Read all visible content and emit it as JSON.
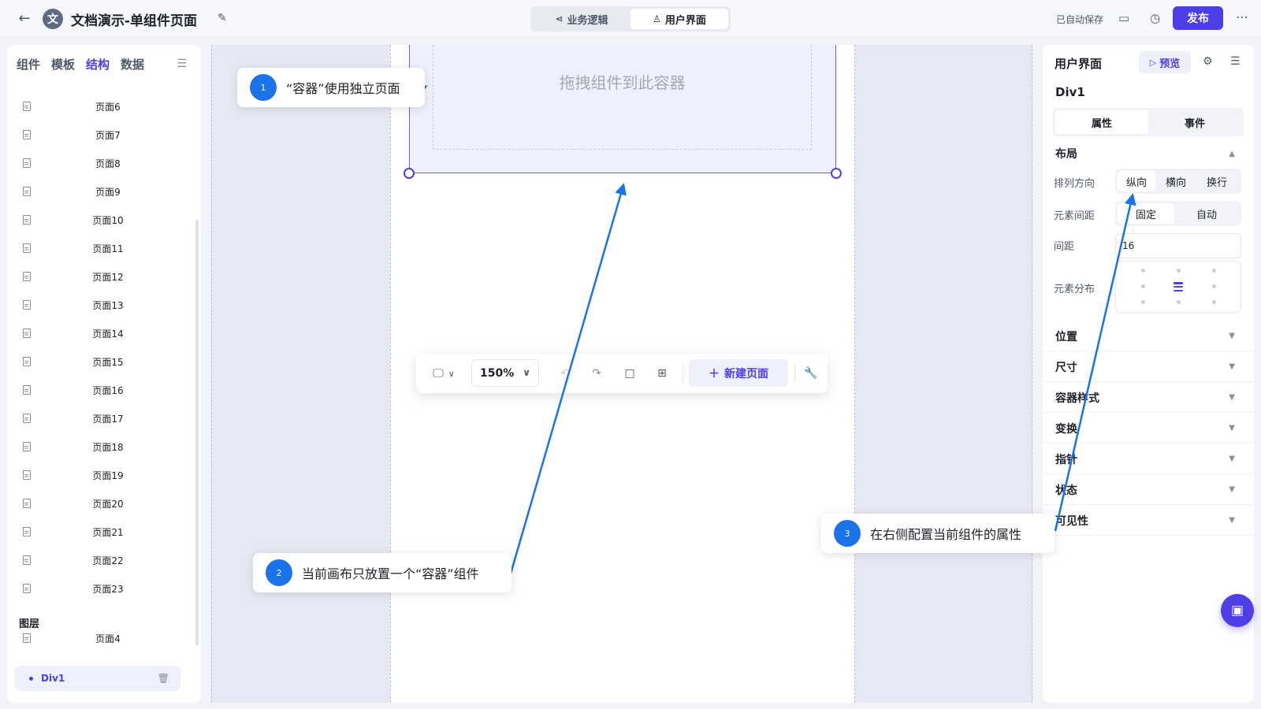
{
  "header": {
    "back_icon": "arrow-left-icon",
    "logo_char": "文",
    "title": "文档演示-单组件页面",
    "mode_tabs": [
      {
        "label": "业务逻辑",
        "icon": "share-icon"
      },
      {
        "label": "用户界面",
        "icon": "user-icon"
      }
    ],
    "autosave": "已自动保存",
    "publish_label": "发布"
  },
  "left_panel": {
    "tabs": [
      "组件",
      "模板",
      "结构",
      "数据"
    ],
    "active_tab": "结构",
    "pages": [
      "页面6",
      "页面7",
      "页面8",
      "页面9",
      "页面10",
      "页面11",
      "页面12",
      "页面13",
      "页面14",
      "页面15",
      "页面16",
      "页面17",
      "页面18",
      "页面19",
      "页面20",
      "页面21",
      "页面22",
      "页面23"
    ],
    "layers_title": "图层",
    "layer_page": "页面4",
    "layer_component": "Div1"
  },
  "canvas": {
    "drop_placeholder": "拖拽组件到此容器",
    "zoom": "150%",
    "new_page_label": "新建页面"
  },
  "right_panel": {
    "title": "用户界面",
    "preview_label": "预览",
    "component_name": "Div1",
    "tabs": [
      "属性",
      "事件"
    ],
    "layout_section": "布局",
    "direction_label": "排列方向",
    "direction_options": [
      "纵向",
      "横向",
      "换行"
    ],
    "gap_mode_label": "元素间距",
    "gap_mode_options": [
      "固定",
      "自动"
    ],
    "gap_label": "间距",
    "gap_value": "16",
    "distribution_label": "元素分布",
    "sections": [
      "位置",
      "尺寸",
      "容器样式",
      "变换",
      "指针",
      "状态",
      "可见性"
    ]
  },
  "annotations": [
    {
      "num": "1",
      "text": "“容器”使用独立页面"
    },
    {
      "num": "2",
      "text": "当前画布只放置一个“容器”组件"
    },
    {
      "num": "3",
      "text": "在右侧配置当前组件的属性"
    }
  ],
  "colors": {
    "accent": "#4e3ee6",
    "annotation_blue": "#1a73e8"
  }
}
